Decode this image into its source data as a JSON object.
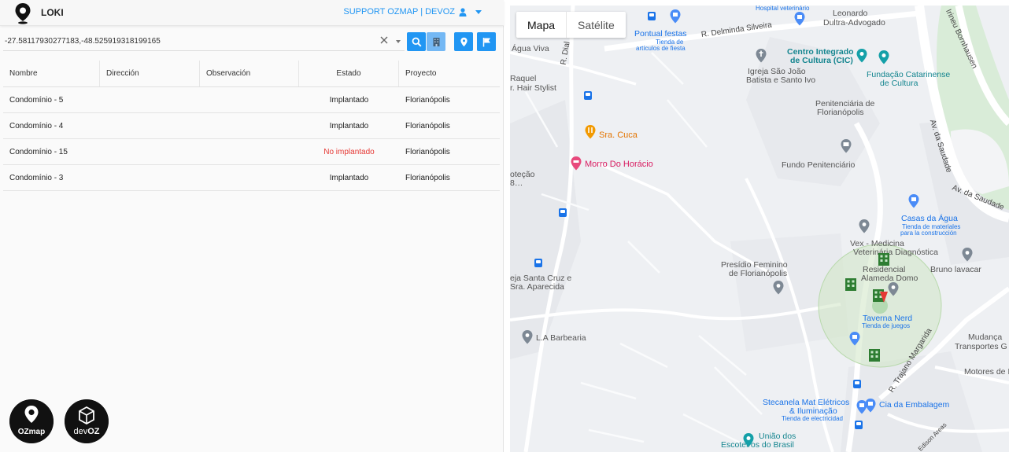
{
  "app": {
    "title": "LOKI"
  },
  "account": {
    "label": "SUPPORT OZMAP | DEVOZ"
  },
  "search": {
    "value": "-27.58117930277183,-48.525919318199165"
  },
  "table": {
    "headers": [
      "Nombre",
      "Dirección",
      "Observación",
      "Estado",
      "Proyecto"
    ],
    "rows": [
      {
        "nombre": "Condomínio - 5",
        "direccion": "",
        "observacion": "",
        "estado": "Implantado",
        "proyecto": "Florianópolis"
      },
      {
        "nombre": "Condomínio - 4",
        "direccion": "",
        "observacion": "",
        "estado": "Implantado",
        "proyecto": "Florianópolis"
      },
      {
        "nombre": "Condomínio - 15",
        "direccion": "",
        "observacion": "",
        "estado": "No implantado",
        "proyecto": "Florianópolis"
      },
      {
        "nombre": "Condomínio - 3",
        "direccion": "",
        "observacion": "",
        "estado": "Implantado",
        "proyecto": "Florianópolis"
      }
    ]
  },
  "brands": {
    "ozmap": "OZmap",
    "devoz_dev": "dev",
    "devoz_oz": "OZ"
  },
  "map": {
    "toggle": {
      "map": "Mapa",
      "satellite": "Satélite"
    },
    "labels": {
      "hospital": "Hospital veterinário",
      "leonardo": "Leonardo",
      "leonardo2": "Dultra-Advogado",
      "pontual": "Pontual festas",
      "pontual_sub1": "Tienda de",
      "pontual_sub2": "artículos de fiesta",
      "delminda": "R. Delminda Silveira",
      "agua_viva": "Água Viva",
      "cic1": "Centro Integrado",
      "cic2": "de Cultura (CIC)",
      "fcc1": "Fundação Catarinense",
      "fcc2": "de Cultura",
      "igreja1": "Igreja São João",
      "igreja2": "Batista e Santo Ivo",
      "raquel1": "Raquel",
      "raquel2": "r. Hair Stylist",
      "penit1": "Penitenciária de",
      "penit2": "Florianópolis",
      "cuca": "Sra. Cuca",
      "horacio": "Morro Do Horácio",
      "fundo": "Fundo Penitenciário",
      "protecao1": "oteção",
      "protecao2": "8…",
      "saudade1": "Av. da Saudade",
      "saudade2": "Av. da Saudade",
      "casas1": "Casas da Água",
      "casas2": "Tienda de materiales",
      "casas3": "para la construcción",
      "vex1": "Vex - Medicina",
      "vex2": "Veterinária Diagnóstica",
      "bruno": "Bruno lavacar",
      "presidio1": "Presídio Feminino",
      "presidio2": "de Florianópolis",
      "resid1": "Residencial",
      "resid2": "Alameda Domo",
      "igreja_sc1": "eja Santa Cruz e",
      "igreja_sc2": "Sra. Aparecida",
      "taverna1": "Taverna Nerd",
      "taverna2": "Tienda de juegos",
      "barbearia": "L.A Barbearia",
      "mudanca1": "Mudança",
      "mudanca2": "Transportes G",
      "trajano": "R. Trajano Margarida",
      "motores": "Motores de Po",
      "stecanela1": "Stecanela Mat Elétricos",
      "stecanela2": "& Iluminação",
      "stecanela3": "Tienda de electricidad",
      "embalagem": "Cia da Embalagem",
      "uniao1": "União dos",
      "uniao2": "Escoteiros do Brasil",
      "edison": "Edison Areas",
      "dial": "R. Dial",
      "bornhausen": "Irineu Bornhausen"
    }
  }
}
